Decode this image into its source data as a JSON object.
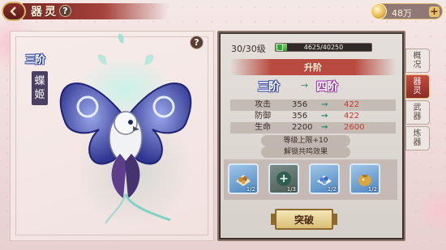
{
  "header": {
    "title": "器灵",
    "help": "?",
    "currency": "48万",
    "currency_add": "+"
  },
  "spirit": {
    "rank": "三阶",
    "name": "蝶姬",
    "help": "?"
  },
  "level": {
    "text": "30/30级",
    "exp_text": "4625/40250",
    "exp_fraction": 0.115
  },
  "upgrade": {
    "label": "升阶",
    "rank_from": "三阶",
    "rank_arrow": "→",
    "rank_to": "四阶"
  },
  "stats": [
    {
      "name": "攻击",
      "current": "356",
      "arrow": "→",
      "next": "422"
    },
    {
      "name": "防御",
      "current": "356",
      "arrow": "→",
      "next": "422"
    },
    {
      "name": "生命",
      "current": "2200",
      "arrow": "→",
      "next": "2600"
    }
  ],
  "info": {
    "level_cap": "等级上限+10",
    "unlock": "解锁共鸣效果"
  },
  "materials": [
    {
      "icon": "grain-bundle-icon",
      "count": "1/2"
    },
    {
      "icon": "add-plus-icon",
      "count": "1/3"
    },
    {
      "icon": "blue-pearls-icon",
      "count": "1/2"
    },
    {
      "icon": "gold-sack-icon",
      "count": "1/2"
    }
  ],
  "break_button": "突破",
  "side_tabs": [
    {
      "label": "概况",
      "active": false
    },
    {
      "label": "器灵",
      "active": true
    },
    {
      "label": "武器",
      "active": false
    },
    {
      "label": "炼器",
      "active": false
    }
  ],
  "colors": {
    "accent": "#b84a40",
    "increase": "#c23a2f",
    "exp": "#3f9d3b"
  }
}
